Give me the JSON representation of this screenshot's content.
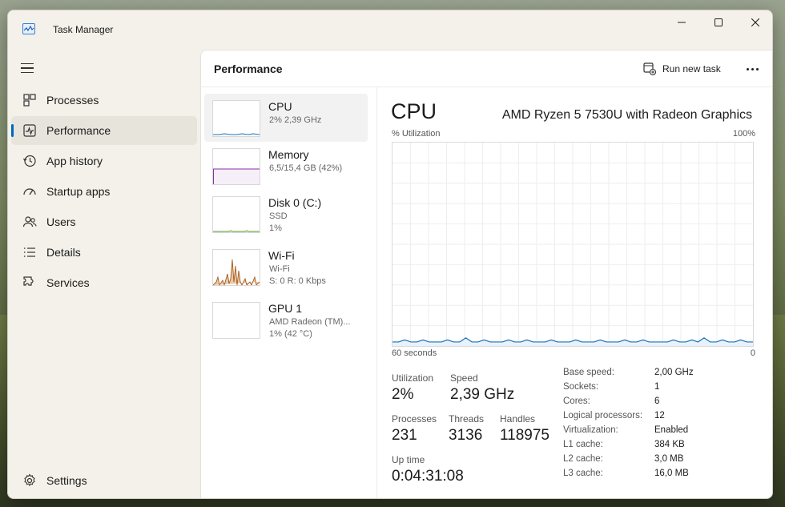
{
  "window": {
    "title": "Task Manager",
    "controls": {
      "minimize": "minimize-icon",
      "maximize": "maximize-icon",
      "close": "close-icon"
    }
  },
  "nav": {
    "items": [
      {
        "label": "Processes",
        "icon": "processes-icon",
        "active": false
      },
      {
        "label": "Performance",
        "icon": "performance-icon",
        "active": true
      },
      {
        "label": "App history",
        "icon": "app-history-icon",
        "active": false
      },
      {
        "label": "Startup apps",
        "icon": "startup-apps-icon",
        "active": false
      },
      {
        "label": "Users",
        "icon": "users-icon",
        "active": false
      },
      {
        "label": "Details",
        "icon": "details-icon",
        "active": false
      },
      {
        "label": "Services",
        "icon": "services-icon",
        "active": false
      }
    ],
    "settings_label": "Settings"
  },
  "header": {
    "title": "Performance",
    "run_new_task": "Run new task"
  },
  "devices": [
    {
      "name": "CPU",
      "lines": [
        "2% 2,39 GHz"
      ]
    },
    {
      "name": "Memory",
      "lines": [
        "6,5/15,4 GB (42%)"
      ]
    },
    {
      "name": "Disk 0 (C:)",
      "lines": [
        "SSD",
        "1%"
      ]
    },
    {
      "name": "Wi-Fi",
      "lines": [
        "Wi-Fi",
        "S: 0 R: 0 Kbps"
      ]
    },
    {
      "name": "GPU 1",
      "lines": [
        "AMD Radeon (TM)...",
        "1% (42 °C)"
      ]
    }
  ],
  "detail": {
    "title": "CPU",
    "model": "AMD Ryzen 5 7530U with Radeon Graphics",
    "util_label": "% Utilization",
    "util_max": "100%",
    "time_left": "60 seconds",
    "time_right": "0",
    "stats": {
      "utilization": {
        "label": "Utilization",
        "value": "2%"
      },
      "speed": {
        "label": "Speed",
        "value": "2,39 GHz"
      },
      "processes": {
        "label": "Processes",
        "value": "231"
      },
      "threads": {
        "label": "Threads",
        "value": "3136"
      },
      "handles": {
        "label": "Handles",
        "value": "118975"
      },
      "uptime": {
        "label": "Up time",
        "value": "0:04:31:08"
      }
    },
    "specs": [
      {
        "key": "Base speed:",
        "value": "2,00 GHz"
      },
      {
        "key": "Sockets:",
        "value": "1"
      },
      {
        "key": "Cores:",
        "value": "6"
      },
      {
        "key": "Logical processors:",
        "value": "12"
      },
      {
        "key": "Virtualization:",
        "value": "Enabled"
      },
      {
        "key": "L1 cache:",
        "value": "384 KB"
      },
      {
        "key": "L2 cache:",
        "value": "3,0 MB"
      },
      {
        "key": "L3 cache:",
        "value": "16,0 MB"
      }
    ]
  },
  "colors": {
    "accent": "#0067c0",
    "cpu_line": "#1a73b8",
    "memory_line": "#8b2fa0",
    "wifi_fill": "#a85a1a",
    "disk_line": "#4d9a2a"
  },
  "chart_data": {
    "type": "line",
    "ylim": [
      0,
      100
    ],
    "xlim_seconds": [
      60,
      0
    ],
    "series": [
      {
        "values": [
          2,
          2,
          3,
          2,
          2,
          3,
          2,
          2,
          2,
          3,
          2,
          2,
          4,
          2,
          2,
          3,
          2,
          2,
          2,
          3,
          2,
          2,
          3,
          2,
          2,
          2,
          3,
          2,
          2,
          2,
          3,
          2,
          2,
          2,
          3,
          2,
          2,
          2,
          3,
          2,
          2,
          3,
          2,
          2,
          2,
          2,
          3,
          2,
          2,
          3,
          2,
          4,
          2,
          2,
          3,
          2,
          2,
          3,
          2,
          2
        ]
      }
    ]
  }
}
